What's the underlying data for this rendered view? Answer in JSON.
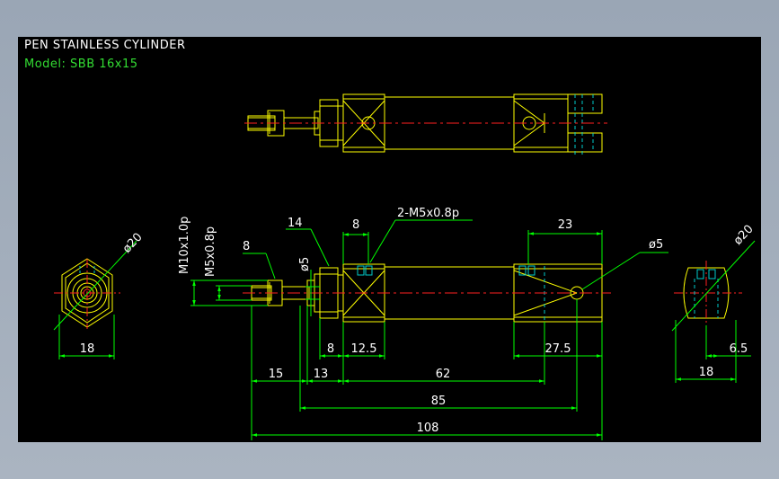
{
  "header": {
    "title": "PEN STAINLESS CYLINDER",
    "model": "Model: SBB 16x15"
  },
  "colors": {
    "background": "#000000",
    "outline": "#ffff00",
    "dimension": "#00ff00",
    "centerline": "#ff2020",
    "hidden": "#00cccc",
    "text": "#ffffff"
  },
  "dimensions": {
    "left_phi20": "ø20",
    "left_18": "18",
    "m10": "M10x1.0p",
    "m5": "M5x0.8p",
    "d8_nut": "8",
    "d14": "14",
    "phi5_small": "ø5",
    "d8_top": "8",
    "thread_note": "2-M5x0.8p",
    "d23": "23",
    "phi5_right": "ø5",
    "d8_bottom": "8",
    "d12_5": "12.5",
    "d27_5": "27.5",
    "d15": "15",
    "d13": "13",
    "d62": "62",
    "d85": "85",
    "d108": "108",
    "right_phi20": "ø20",
    "right_18": "18",
    "right_6_5": "6.5"
  }
}
